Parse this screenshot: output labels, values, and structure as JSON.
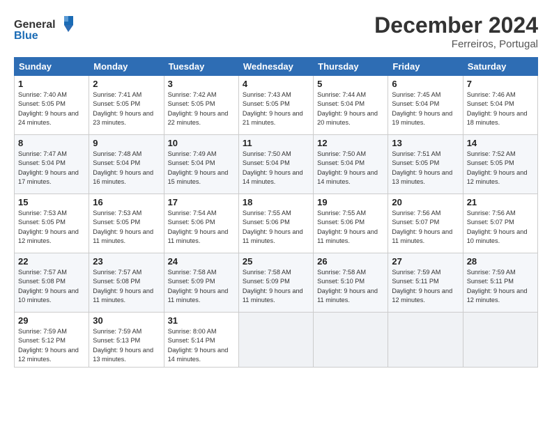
{
  "header": {
    "logo_general": "General",
    "logo_blue": "Blue",
    "month_title": "December 2024",
    "location": "Ferreiros, Portugal"
  },
  "weekdays": [
    "Sunday",
    "Monday",
    "Tuesday",
    "Wednesday",
    "Thursday",
    "Friday",
    "Saturday"
  ],
  "weeks": [
    [
      {
        "day": "1",
        "sunrise": "Sunrise: 7:40 AM",
        "sunset": "Sunset: 5:05 PM",
        "daylight": "Daylight: 9 hours and 24 minutes."
      },
      {
        "day": "2",
        "sunrise": "Sunrise: 7:41 AM",
        "sunset": "Sunset: 5:05 PM",
        "daylight": "Daylight: 9 hours and 23 minutes."
      },
      {
        "day": "3",
        "sunrise": "Sunrise: 7:42 AM",
        "sunset": "Sunset: 5:05 PM",
        "daylight": "Daylight: 9 hours and 22 minutes."
      },
      {
        "day": "4",
        "sunrise": "Sunrise: 7:43 AM",
        "sunset": "Sunset: 5:05 PM",
        "daylight": "Daylight: 9 hours and 21 minutes."
      },
      {
        "day": "5",
        "sunrise": "Sunrise: 7:44 AM",
        "sunset": "Sunset: 5:04 PM",
        "daylight": "Daylight: 9 hours and 20 minutes."
      },
      {
        "day": "6",
        "sunrise": "Sunrise: 7:45 AM",
        "sunset": "Sunset: 5:04 PM",
        "daylight": "Daylight: 9 hours and 19 minutes."
      },
      {
        "day": "7",
        "sunrise": "Sunrise: 7:46 AM",
        "sunset": "Sunset: 5:04 PM",
        "daylight": "Daylight: 9 hours and 18 minutes."
      }
    ],
    [
      {
        "day": "8",
        "sunrise": "Sunrise: 7:47 AM",
        "sunset": "Sunset: 5:04 PM",
        "daylight": "Daylight: 9 hours and 17 minutes."
      },
      {
        "day": "9",
        "sunrise": "Sunrise: 7:48 AM",
        "sunset": "Sunset: 5:04 PM",
        "daylight": "Daylight: 9 hours and 16 minutes."
      },
      {
        "day": "10",
        "sunrise": "Sunrise: 7:49 AM",
        "sunset": "Sunset: 5:04 PM",
        "daylight": "Daylight: 9 hours and 15 minutes."
      },
      {
        "day": "11",
        "sunrise": "Sunrise: 7:50 AM",
        "sunset": "Sunset: 5:04 PM",
        "daylight": "Daylight: 9 hours and 14 minutes."
      },
      {
        "day": "12",
        "sunrise": "Sunrise: 7:50 AM",
        "sunset": "Sunset: 5:04 PM",
        "daylight": "Daylight: 9 hours and 14 minutes."
      },
      {
        "day": "13",
        "sunrise": "Sunrise: 7:51 AM",
        "sunset": "Sunset: 5:05 PM",
        "daylight": "Daylight: 9 hours and 13 minutes."
      },
      {
        "day": "14",
        "sunrise": "Sunrise: 7:52 AM",
        "sunset": "Sunset: 5:05 PM",
        "daylight": "Daylight: 9 hours and 12 minutes."
      }
    ],
    [
      {
        "day": "15",
        "sunrise": "Sunrise: 7:53 AM",
        "sunset": "Sunset: 5:05 PM",
        "daylight": "Daylight: 9 hours and 12 minutes."
      },
      {
        "day": "16",
        "sunrise": "Sunrise: 7:53 AM",
        "sunset": "Sunset: 5:05 PM",
        "daylight": "Daylight: 9 hours and 11 minutes."
      },
      {
        "day": "17",
        "sunrise": "Sunrise: 7:54 AM",
        "sunset": "Sunset: 5:06 PM",
        "daylight": "Daylight: 9 hours and 11 minutes."
      },
      {
        "day": "18",
        "sunrise": "Sunrise: 7:55 AM",
        "sunset": "Sunset: 5:06 PM",
        "daylight": "Daylight: 9 hours and 11 minutes."
      },
      {
        "day": "19",
        "sunrise": "Sunrise: 7:55 AM",
        "sunset": "Sunset: 5:06 PM",
        "daylight": "Daylight: 9 hours and 11 minutes."
      },
      {
        "day": "20",
        "sunrise": "Sunrise: 7:56 AM",
        "sunset": "Sunset: 5:07 PM",
        "daylight": "Daylight: 9 hours and 11 minutes."
      },
      {
        "day": "21",
        "sunrise": "Sunrise: 7:56 AM",
        "sunset": "Sunset: 5:07 PM",
        "daylight": "Daylight: 9 hours and 10 minutes."
      }
    ],
    [
      {
        "day": "22",
        "sunrise": "Sunrise: 7:57 AM",
        "sunset": "Sunset: 5:08 PM",
        "daylight": "Daylight: 9 hours and 10 minutes."
      },
      {
        "day": "23",
        "sunrise": "Sunrise: 7:57 AM",
        "sunset": "Sunset: 5:08 PM",
        "daylight": "Daylight: 9 hours and 11 minutes."
      },
      {
        "day": "24",
        "sunrise": "Sunrise: 7:58 AM",
        "sunset": "Sunset: 5:09 PM",
        "daylight": "Daylight: 9 hours and 11 minutes."
      },
      {
        "day": "25",
        "sunrise": "Sunrise: 7:58 AM",
        "sunset": "Sunset: 5:09 PM",
        "daylight": "Daylight: 9 hours and 11 minutes."
      },
      {
        "day": "26",
        "sunrise": "Sunrise: 7:58 AM",
        "sunset": "Sunset: 5:10 PM",
        "daylight": "Daylight: 9 hours and 11 minutes."
      },
      {
        "day": "27",
        "sunrise": "Sunrise: 7:59 AM",
        "sunset": "Sunset: 5:11 PM",
        "daylight": "Daylight: 9 hours and 12 minutes."
      },
      {
        "day": "28",
        "sunrise": "Sunrise: 7:59 AM",
        "sunset": "Sunset: 5:11 PM",
        "daylight": "Daylight: 9 hours and 12 minutes."
      }
    ],
    [
      {
        "day": "29",
        "sunrise": "Sunrise: 7:59 AM",
        "sunset": "Sunset: 5:12 PM",
        "daylight": "Daylight: 9 hours and 12 minutes."
      },
      {
        "day": "30",
        "sunrise": "Sunrise: 7:59 AM",
        "sunset": "Sunset: 5:13 PM",
        "daylight": "Daylight: 9 hours and 13 minutes."
      },
      {
        "day": "31",
        "sunrise": "Sunrise: 8:00 AM",
        "sunset": "Sunset: 5:14 PM",
        "daylight": "Daylight: 9 hours and 14 minutes."
      },
      null,
      null,
      null,
      null
    ]
  ]
}
